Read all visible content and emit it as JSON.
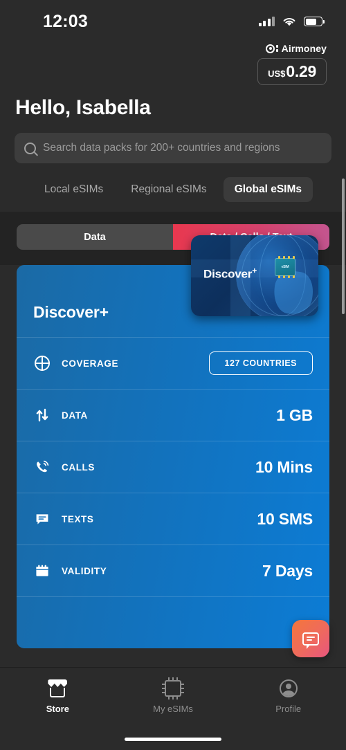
{
  "status_bar": {
    "time": "12:03",
    "signal_icon": "cellular-signal-icon",
    "wifi_icon": "wifi-icon",
    "battery_icon": "battery-icon"
  },
  "airmoney": {
    "icon": "airmoney-coin-icon",
    "label": "Airmoney",
    "currency": "US$",
    "amount": "0.29"
  },
  "header": {
    "greeting": "Hello, Isabella"
  },
  "search": {
    "icon": "search-icon",
    "placeholder": "Search data packs for 200+ countries and regions",
    "value": ""
  },
  "category_tabs": [
    {
      "label": "Local eSIMs",
      "active": false
    },
    {
      "label": "Regional eSIMs",
      "active": false
    },
    {
      "label": "Global eSIMs",
      "active": true
    }
  ],
  "segmented_toggle": {
    "options": [
      {
        "label": "Data",
        "active": false
      },
      {
        "label": "Data / Calls / Text",
        "active": true
      }
    ],
    "active_gradient_from": "#e8384f",
    "active_gradient_to": "#c4558f",
    "inactive_bg": "#4a4a4a"
  },
  "plan_card": {
    "title": "Discover+",
    "thumbnail": {
      "title": "Discover",
      "superscript": "+",
      "chip_label": "eSIM",
      "globe_icon": "globe-graphic",
      "chip_icon": "esim-chip-icon"
    },
    "accent_from": "#1b6aa5",
    "accent_to": "#0c7cd5",
    "rows": [
      {
        "icon": "globe-icon",
        "label": "COVERAGE",
        "value": "127 COUNTRIES",
        "is_badge": true
      },
      {
        "icon": "data-arrows-icon",
        "label": "DATA",
        "value": "1 GB",
        "is_badge": false
      },
      {
        "icon": "phone-icon",
        "label": "CALLS",
        "value": "10 Mins",
        "is_badge": false
      },
      {
        "icon": "message-icon",
        "label": "TEXTS",
        "value": "10 SMS",
        "is_badge": false
      },
      {
        "icon": "calendar-icon",
        "label": "VALIDITY",
        "value": "7 Days",
        "is_badge": false
      }
    ]
  },
  "chat_fab": {
    "icon": "chat-bubble-icon",
    "gradient_from": "#f4763c",
    "gradient_to": "#e8567e"
  },
  "bottom_nav": [
    {
      "label": "Store",
      "icon": "storefront-icon",
      "active": true
    },
    {
      "label": "My eSIMs",
      "icon": "sim-chip-icon",
      "active": false
    },
    {
      "label": "Profile",
      "icon": "avatar-icon",
      "active": false
    }
  ]
}
